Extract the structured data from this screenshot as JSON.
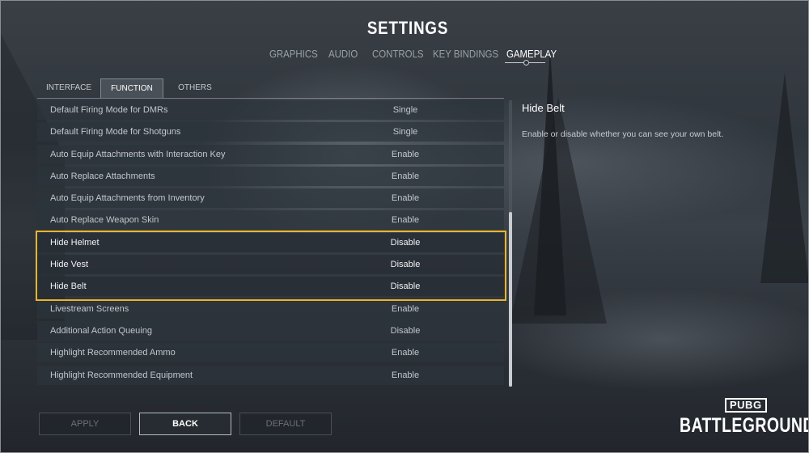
{
  "header": {
    "title": "SETTINGS"
  },
  "main_tabs": [
    {
      "label": "GRAPHICS"
    },
    {
      "label": "AUDIO"
    },
    {
      "label": "CONTROLS"
    },
    {
      "label": "KEY BINDINGS"
    },
    {
      "label": "GAMEPLAY",
      "active": true
    }
  ],
  "sub_tabs": [
    {
      "label": "INTERFACE"
    },
    {
      "label": "FUNCTION",
      "active": true
    },
    {
      "label": "OTHERS"
    }
  ],
  "settings": [
    {
      "label": "Default Firing Mode for DMRs",
      "value": "Single"
    },
    {
      "label": "Default Firing Mode for Shotguns",
      "value": "Single"
    },
    {
      "label": "Auto Equip Attachments with Interaction Key",
      "value": "Enable"
    },
    {
      "label": "Auto Replace Attachments",
      "value": "Enable"
    },
    {
      "label": "Auto Equip Attachments from Inventory",
      "value": "Enable"
    },
    {
      "label": "Auto Replace Weapon Skin",
      "value": "Enable"
    },
    {
      "label": "Hide Helmet",
      "value": "Disable",
      "highlighted": true
    },
    {
      "label": "Hide Vest",
      "value": "Disable",
      "highlighted": true
    },
    {
      "label": "Hide Belt",
      "value": "Disable",
      "highlighted": true
    },
    {
      "label": "Livestream Screens",
      "value": "Enable"
    },
    {
      "label": "Additional Action Queuing",
      "value": "Disable"
    },
    {
      "label": "Highlight Recommended Ammo",
      "value": "Enable"
    },
    {
      "label": "Highlight Recommended Equipment",
      "value": "Enable"
    }
  ],
  "description": {
    "title": "Hide Belt",
    "text": "Enable or disable whether you can see your own belt."
  },
  "buttons": {
    "apply": "APPLY",
    "back": "BACK",
    "default": "DEFAULT"
  },
  "logo": {
    "top": "PUBG",
    "bottom": "BATTLEGROUNDS"
  },
  "colors": {
    "highlight_border": "#e8b62a",
    "active_text": "#ffffff",
    "inactive_text": "#9aa1a8"
  }
}
